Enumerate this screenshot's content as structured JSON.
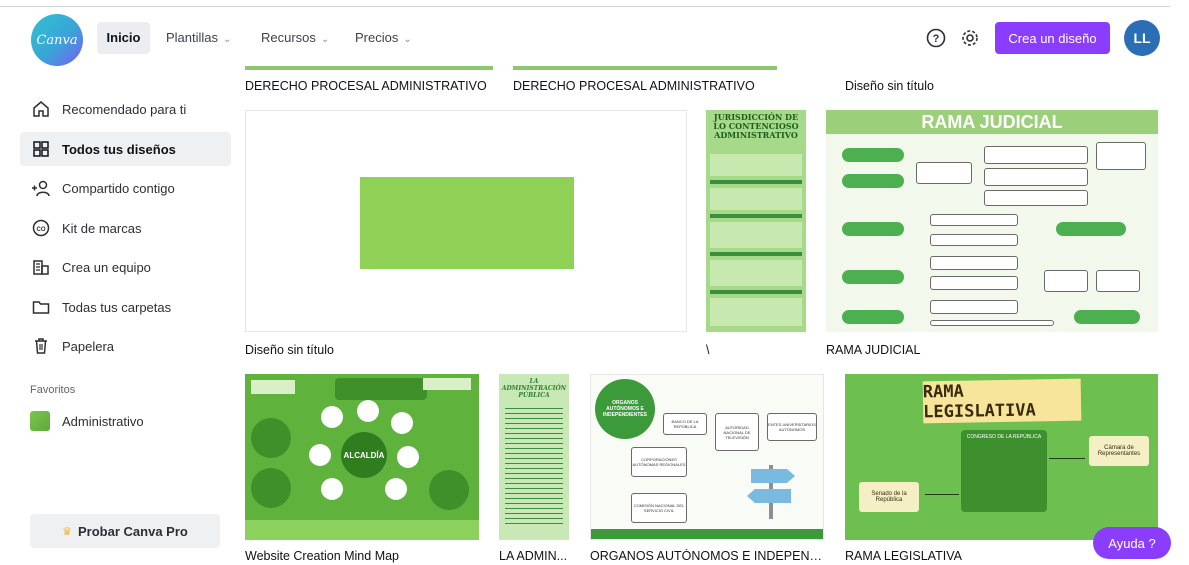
{
  "header": {
    "logo_text": "Canva",
    "nav": [
      {
        "label": "Inicio"
      },
      {
        "label": "Plantillas"
      },
      {
        "label": "Recursos"
      },
      {
        "label": "Precios"
      }
    ],
    "create_button": "Crea un diseño",
    "avatar_initials": "LL"
  },
  "sidebar": {
    "items": [
      {
        "label": "Recomendado para ti",
        "icon": "home-icon"
      },
      {
        "label": "Todos tus diseños",
        "icon": "grid-icon",
        "active": true
      },
      {
        "label": "Compartido contigo",
        "icon": "people-icon"
      },
      {
        "label": "Kit de marcas",
        "icon": "brand-kit-icon"
      },
      {
        "label": "Crea un equipo",
        "icon": "building-icon"
      },
      {
        "label": "Todas tus carpetas",
        "icon": "folder-icon"
      },
      {
        "label": "Papelera",
        "icon": "trash-icon"
      }
    ],
    "favorites_title": "Favoritos",
    "favorites": [
      {
        "label": "Administrativo"
      }
    ],
    "pro_button": "Probar Canva Pro"
  },
  "designs": {
    "row0": [
      {
        "title": "DERECHO PROCESAL ADMINISTRATIVO"
      },
      {
        "title": "DERECHO PROCESAL ADMINISTRATIVO"
      },
      {
        "title": "Diseño sin título"
      }
    ],
    "row1": [
      {
        "title": "Diseño sin título"
      },
      {
        "title": "\\"
      },
      {
        "title": "RAMA JUDICIAL"
      }
    ],
    "row2": [
      {
        "title": "Website Creation Mind Map"
      },
      {
        "title": "LA ADMIN..."
      },
      {
        "title": "ORGANOS AUTÓNOMOS E INDEPENDI..."
      },
      {
        "title": "RAMA LEGISLATIVA"
      }
    ],
    "thumb_texts": {
      "jurisdiccion": "JURISDICCIÓN DE LO CONTENCIOSO ADMINISTRATIVO",
      "rama_judicial": "RAMA JUDICIAL",
      "alcaldia": "ALCALDÍA",
      "admin_publica": "LA ADMINISTRACIÓN PÚBLICA",
      "organos": "ORGANOS AUTÓNOMOS E INDEPENDIENTES",
      "organos_boxes": [
        "BANCO DE LA REPÚBLICA",
        "AUTORIDAD NACIONAL DE TELEVISIÓN",
        "ENTES UNIVERSITARIOS AUTÓNOMOS",
        "CORPORACIONES AUTÓNOMAS REGIONALES",
        "COMISIÓN NACIONAL DEL SERVICIO CIVIL"
      ],
      "rama_legislativa": "RAMA LEGISLATIVA",
      "congreso": "CONGRESO DE LA REPÚBLICA",
      "camara": "Cámara de Representantes",
      "senado": "Senado de la República"
    }
  },
  "help_button": "Ayuda ?"
}
